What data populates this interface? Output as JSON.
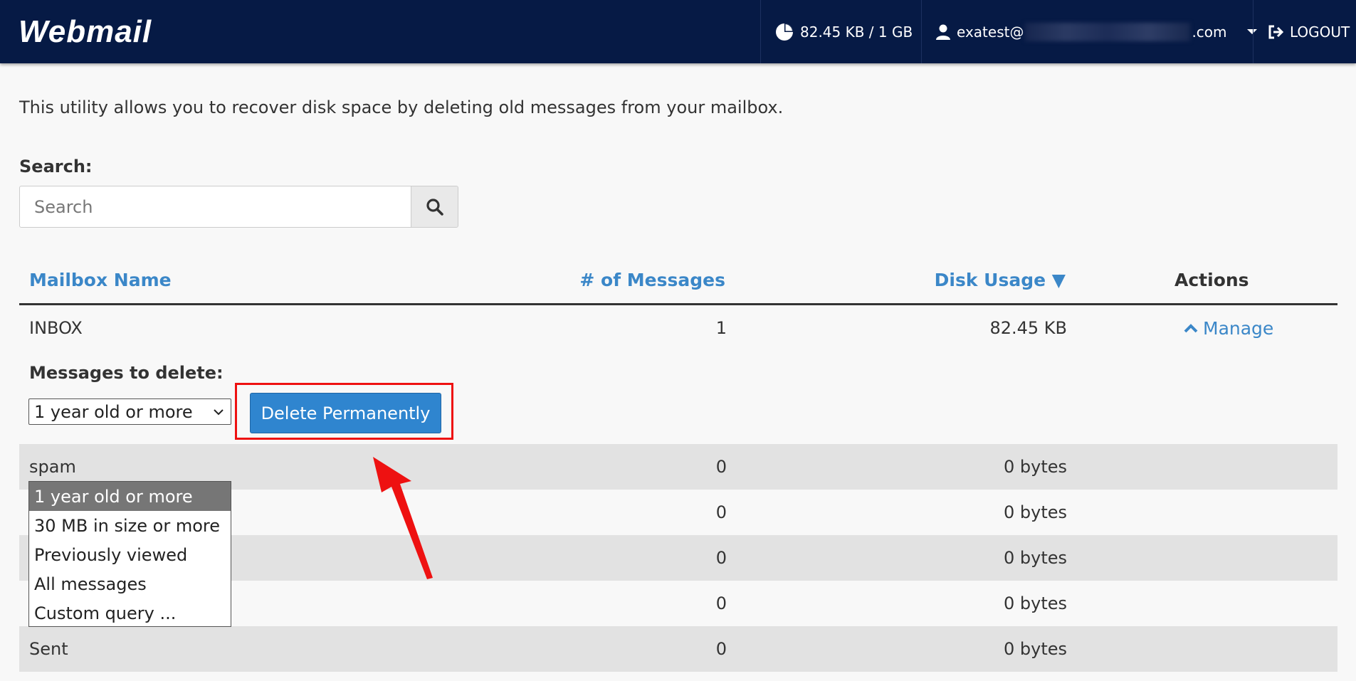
{
  "header": {
    "logo": "Webmail",
    "quota": "82.45 KB / 1 GB",
    "user_prefix": "exatest@",
    "user_suffix": ".com",
    "logout": "LOGOUT"
  },
  "intro": "This utility allows you to recover disk space by deleting old messages from your mailbox.",
  "search": {
    "label": "Search:",
    "placeholder": "Search"
  },
  "table": {
    "headers": {
      "name": "Mailbox Name",
      "messages": "# of Messages",
      "disk": "Disk Usage ▼",
      "actions": "Actions"
    },
    "rows": [
      {
        "name": "INBOX",
        "messages": "1",
        "disk": "82.45 KB",
        "action": "Manage"
      },
      {
        "name": "spam",
        "messages": "0",
        "disk": "0 bytes"
      },
      {
        "name": "",
        "messages": "0",
        "disk": "0 bytes"
      },
      {
        "name": "",
        "messages": "0",
        "disk": "0 bytes"
      },
      {
        "name": "",
        "messages": "0",
        "disk": "0 bytes"
      },
      {
        "name": "Sent",
        "messages": "0",
        "disk": "0 bytes"
      }
    ]
  },
  "delete_panel": {
    "label": "Messages to delete:",
    "selected": "1 year old or more",
    "button": "Delete Permanently",
    "options": [
      "1 year old or more",
      "30 MB in size or more",
      "Previously viewed",
      "All messages",
      "Custom query ..."
    ]
  },
  "colors": {
    "header_bg": "#061a45",
    "link": "#3b87c8",
    "button": "#2f85cf",
    "highlight": "#ee1111",
    "row_shade": "#e2e2e2"
  }
}
